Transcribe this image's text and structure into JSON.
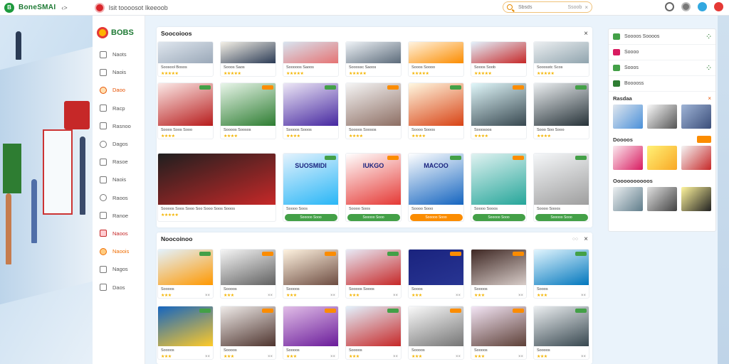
{
  "topbar": {
    "brand_logo": "B",
    "brand_name": "BoneSMAI",
    "brand_ext": "‹>",
    "site_title": "Isit toooosot Ikeeoob",
    "search_placeholder": "Sbsds",
    "search_button": "Ssoob",
    "search_clear": "×",
    "icons": [
      "headset-icon",
      "settings-icon",
      "user-icon",
      "cart-icon"
    ]
  },
  "sidenav": {
    "logo_text": "BOBS",
    "items": [
      {
        "label": "Naots",
        "icon": "document-icon"
      },
      {
        "label": "Naois",
        "icon": "list-icon"
      },
      {
        "label": "Daoo",
        "icon": "tag-icon",
        "state": "active"
      },
      {
        "label": "Racp",
        "icon": "bag-icon"
      },
      {
        "label": "Rasnoo",
        "icon": "camera-icon"
      },
      {
        "label": "Dagos",
        "icon": "globe-icon"
      },
      {
        "label": "Rasoe",
        "icon": "gift-icon"
      },
      {
        "label": "Naois",
        "icon": "folder-icon"
      },
      {
        "label": "Raoos",
        "icon": "box-icon"
      },
      {
        "label": "Ranoe",
        "icon": "gear-icon"
      },
      {
        "label": "Naoos",
        "icon": "grid-icon",
        "state": "red"
      },
      {
        "label": "Naoois",
        "icon": "chart-icon",
        "state": "orange"
      },
      {
        "label": "Nagos",
        "icon": "star-icon"
      },
      {
        "label": "Daos",
        "icon": "help-icon"
      }
    ]
  },
  "section1": {
    "title": "Soocoioos",
    "close": "×",
    "row1": [
      {
        "title": "Soosool Bosos",
        "rating": "★★★★★"
      },
      {
        "title": "Sooos Saos",
        "rating": "★★★★★"
      },
      {
        "title": "Sooooos Saoos",
        "rating": "★★★★★"
      },
      {
        "title": "Sooossc Saoos",
        "rating": "★★★★★"
      },
      {
        "title": "Sooos Soooo",
        "rating": "★★★★★"
      },
      {
        "title": "Sooos Soob",
        "rating": "★★★★★"
      },
      {
        "title": "Sooosstc Scos",
        "rating": "★★★★★"
      }
    ],
    "row2": [
      {
        "title": "Sooos Soos Sooo",
        "rating": "★★★★"
      },
      {
        "title": "Soooos Soosos",
        "rating": "★★★★"
      },
      {
        "title": "Soooos Sooos",
        "rating": "★★★★"
      },
      {
        "title": "Soooos Soosos",
        "rating": "★★★★"
      },
      {
        "title": "Soooo Sooos",
        "rating": "★★★★"
      },
      {
        "title": "Sooosoos",
        "rating": "★★★★"
      },
      {
        "title": "Sooo Soo Sooo",
        "rating": "★★★★"
      }
    ],
    "row3_featured": {
      "title": "Soooos Soos Sooo Soo Sooo Soos Sooos",
      "rating": "★★★★★"
    },
    "row3": [
      {
        "title": "Soooo Soos",
        "thumb_title": "SUOSMIDI",
        "button": "Sooooo Sooo",
        "btn_color": "g"
      },
      {
        "title": "Soooo Soos",
        "thumb_title": "IUKGO",
        "button": "Sooooo Sooo",
        "btn_color": "g"
      },
      {
        "title": "Soooo Sooo",
        "thumb_title": "MACOO",
        "button": "Sooooo Sooo",
        "btn_color": "o"
      },
      {
        "title": "Soooo Sooos",
        "button": "Sooooo Sooo",
        "btn_color": "g"
      },
      {
        "title": "Soooo Sooos",
        "button": "Sooooo Sooo",
        "btn_color": "g"
      }
    ]
  },
  "section2": {
    "title": "Noocoinoo",
    "more": "○○",
    "close": "×",
    "row1": [
      {
        "title": "Soooos",
        "rating": "★★★",
        "x": "××"
      },
      {
        "title": "Soooos",
        "rating": "★★★",
        "x": "××"
      },
      {
        "title": "Soooos",
        "rating": "★★★",
        "x": "××"
      },
      {
        "title": "Soooos Sooos",
        "rating": "★★★",
        "x": "××"
      },
      {
        "title": "Sooos",
        "rating": "★★★",
        "x": "××"
      },
      {
        "title": "Soooos",
        "rating": "★★★",
        "x": "××"
      },
      {
        "title": "Sooos",
        "rating": "★★★",
        "x": "××"
      }
    ],
    "row2": [
      {
        "title": "Soooos",
        "rating": "★★★",
        "x": "××"
      },
      {
        "title": "Soooos",
        "rating": "★★★",
        "x": "××"
      },
      {
        "title": "Soooos",
        "rating": "★★★",
        "x": "××"
      },
      {
        "title": "Soooos",
        "rating": "★★★",
        "x": "××"
      },
      {
        "title": "Soooos",
        "rating": "★★★",
        "x": "××"
      },
      {
        "title": "Soooos",
        "rating": "★★★",
        "x": "××"
      },
      {
        "title": "Soooos",
        "rating": "★★★",
        "x": "××"
      }
    ]
  },
  "rpanel": {
    "rows": [
      {
        "label": "Soooos Soooos",
        "action": "⁘"
      },
      {
        "label": "Soooo",
        "action": ""
      },
      {
        "label": "Sooos",
        "action": "⁘"
      },
      {
        "label": "Booooss",
        "action": ""
      }
    ],
    "sec1": {
      "title": "Rasdaa",
      "action": "×"
    },
    "sec2": {
      "title": "Doooos"
    },
    "sec3": {
      "title": "Ooooooooooos"
    }
  }
}
